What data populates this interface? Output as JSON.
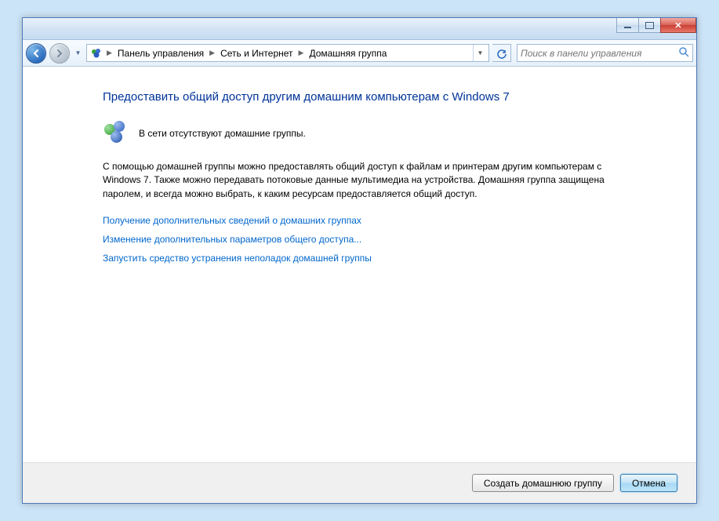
{
  "breadcrumb": {
    "items": [
      "Панель управления",
      "Сеть и Интернет",
      "Домашняя группа"
    ]
  },
  "search": {
    "placeholder": "Поиск в панели управления"
  },
  "page": {
    "heading": "Предоставить общий доступ другим домашним компьютерам с Windows 7",
    "status": "В сети отсутствуют домашние группы.",
    "description": "С помощью домашней группы можно предоставлять общий доступ к файлам и принтерам другим компьютерам с Windows 7. Также можно передавать потоковые данные мультимедиа на устройства. Домашняя группа защищена паролем, и всегда можно выбрать, к каким ресурсам предоставляется общий доступ.",
    "links": [
      "Получение дополнительных сведений о домашних группах",
      "Изменение дополнительных параметров общего доступа...",
      "Запустить средство устранения неполадок домашней группы"
    ]
  },
  "footer": {
    "create_label": "Создать домашнюю группу",
    "cancel_label": "Отмена"
  }
}
